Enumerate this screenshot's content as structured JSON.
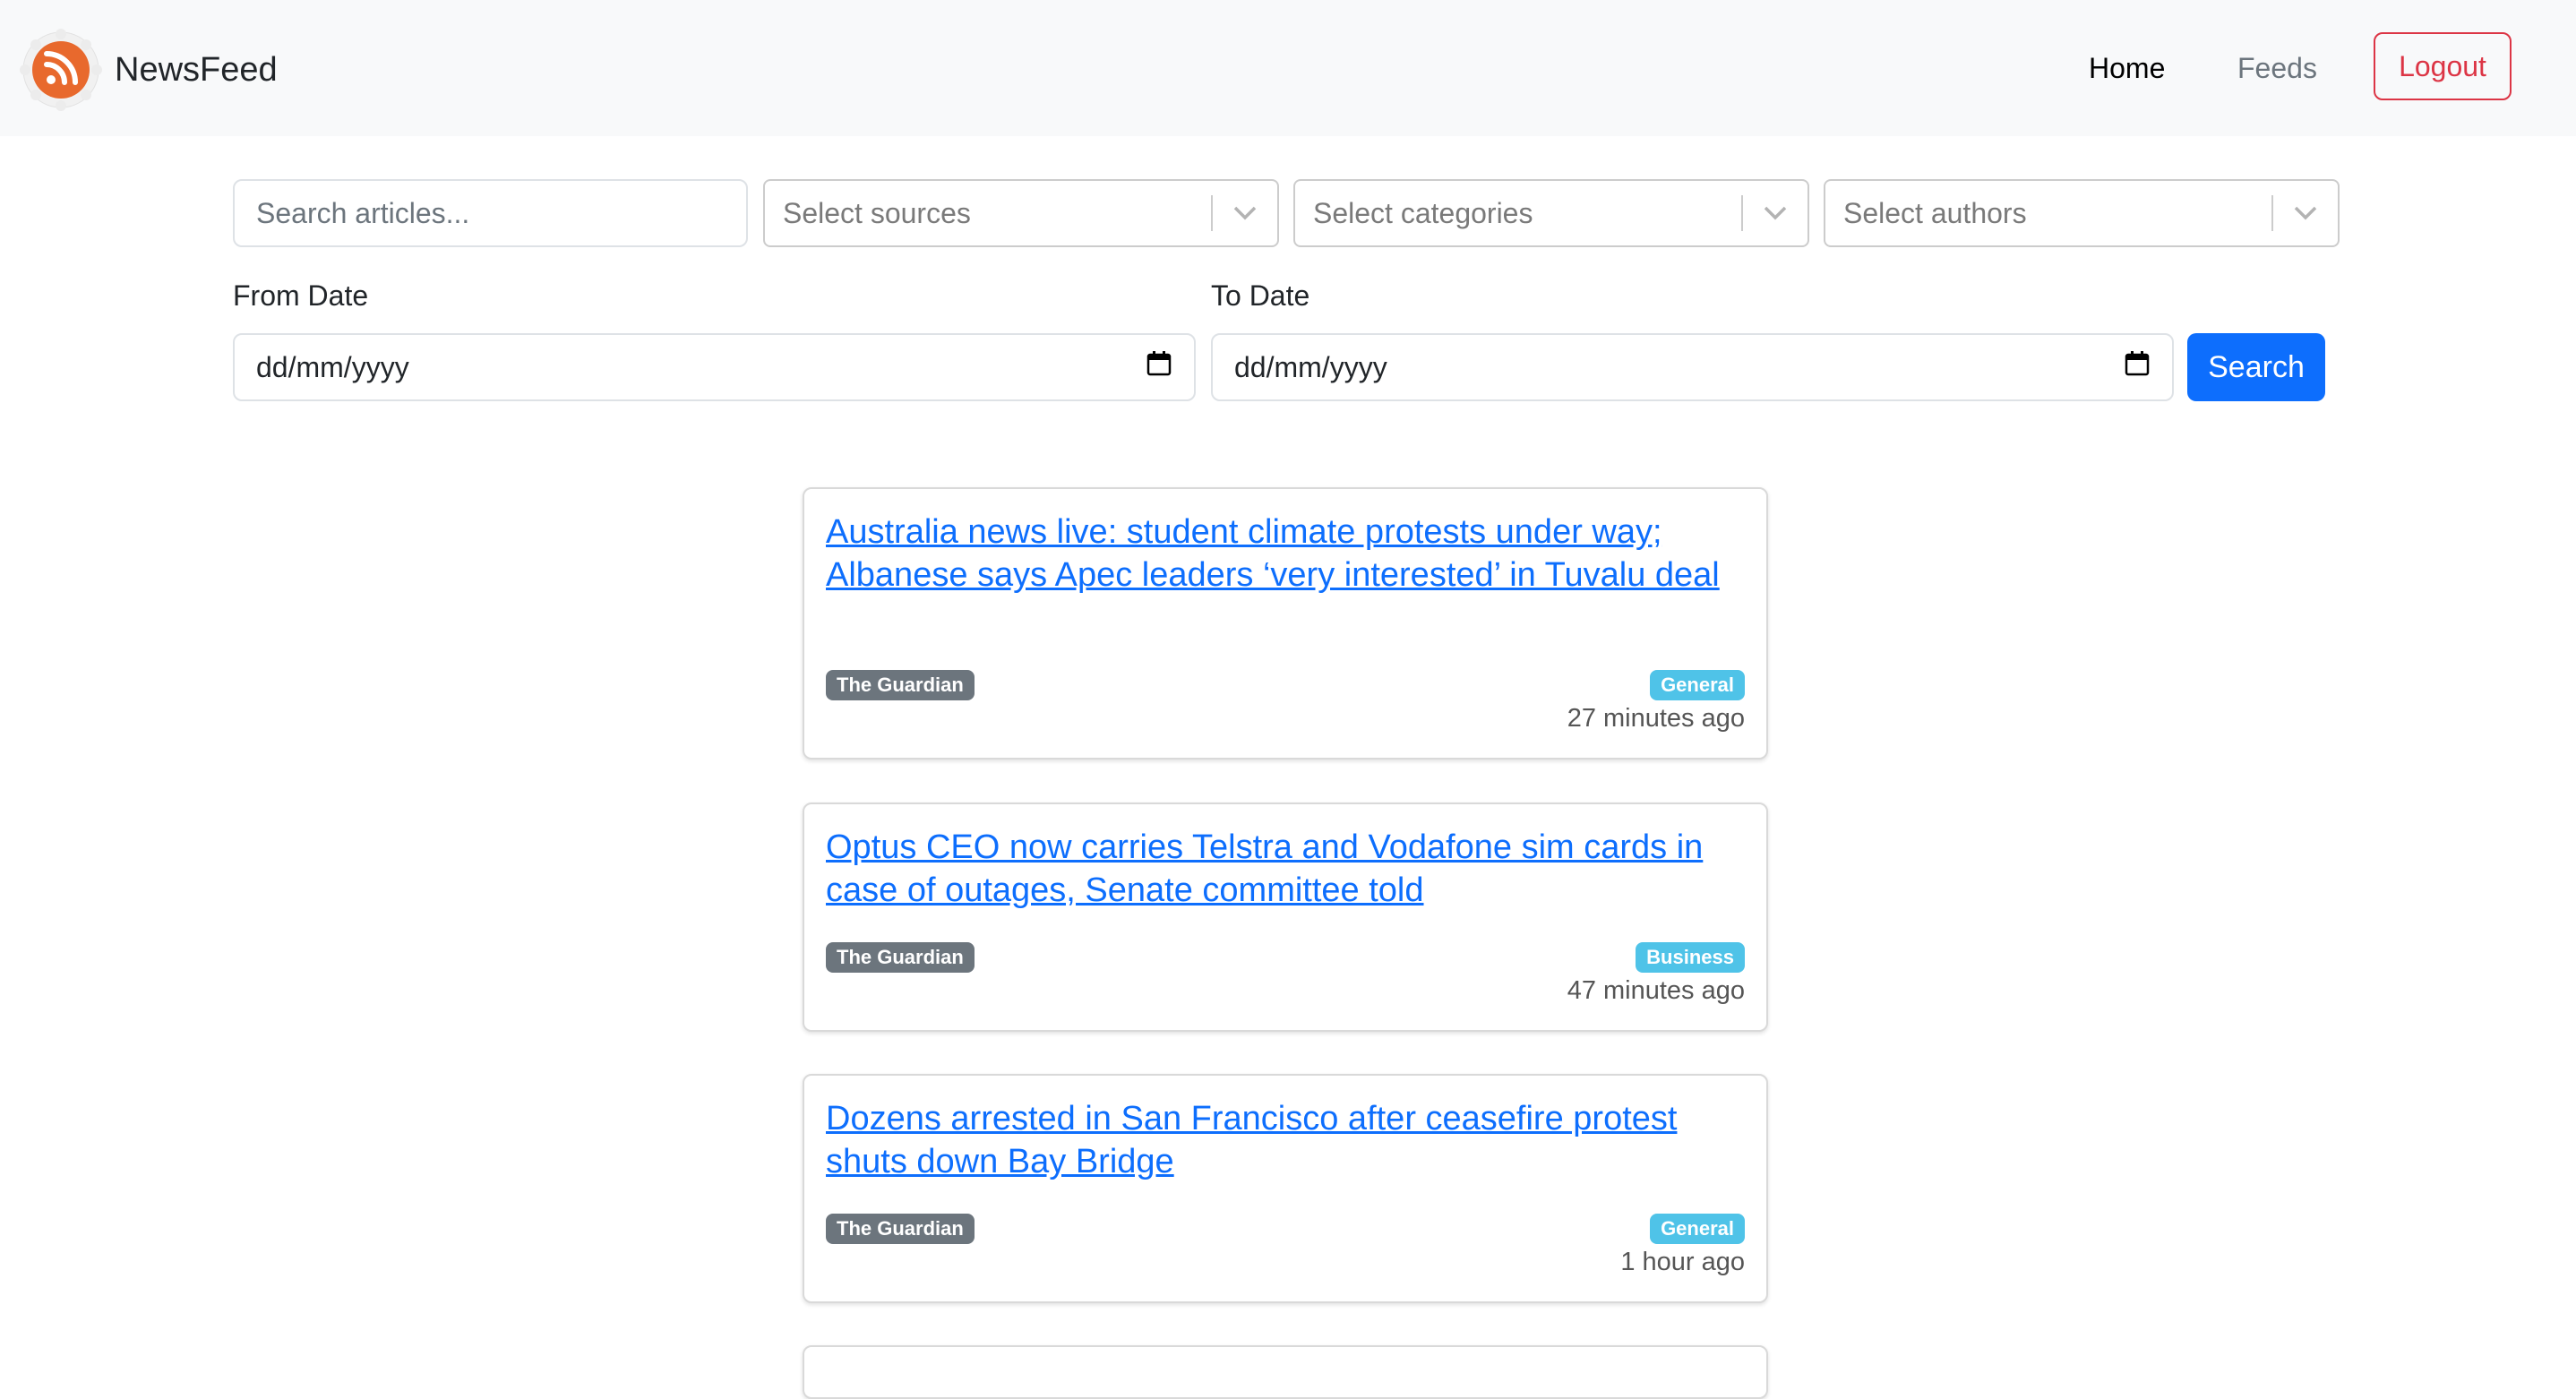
{
  "app": {
    "name": "NewsFeed"
  },
  "nav": {
    "home": "Home",
    "feeds": "Feeds",
    "logout": "Logout"
  },
  "filters": {
    "search_placeholder": "Search articles...",
    "sources_placeholder": "Select sources",
    "categories_placeholder": "Select categories",
    "authors_placeholder": "Select authors",
    "from_label": "From Date",
    "to_label": "To Date",
    "from_value": "dd/mm/yyyy",
    "to_value": "dd/mm/yyyy",
    "search_button": "Search"
  },
  "articles": [
    {
      "title": "Australia news live: student climate protests under way; Albanese says Apec leaders ‘very interested’ in Tuvalu deal",
      "source": "The Guardian",
      "category": "General",
      "time": "27 minutes ago"
    },
    {
      "title": "Optus CEO now carries Telstra and Vodafone sim cards in case of outages, Senate committee told",
      "source": "The Guardian",
      "category": "Business",
      "time": "47 minutes ago"
    },
    {
      "title": "Dozens arrested in San Francisco after ceasefire protest shuts down Bay Bridge",
      "source": "The Guardian",
      "category": "General",
      "time": "1 hour ago"
    }
  ],
  "colors": {
    "primary": "#0d6efd",
    "danger": "#dc3545",
    "badge_source": "#6c757d",
    "badge_category": "#4fc3e8",
    "logo_orange": "#e8692d"
  }
}
